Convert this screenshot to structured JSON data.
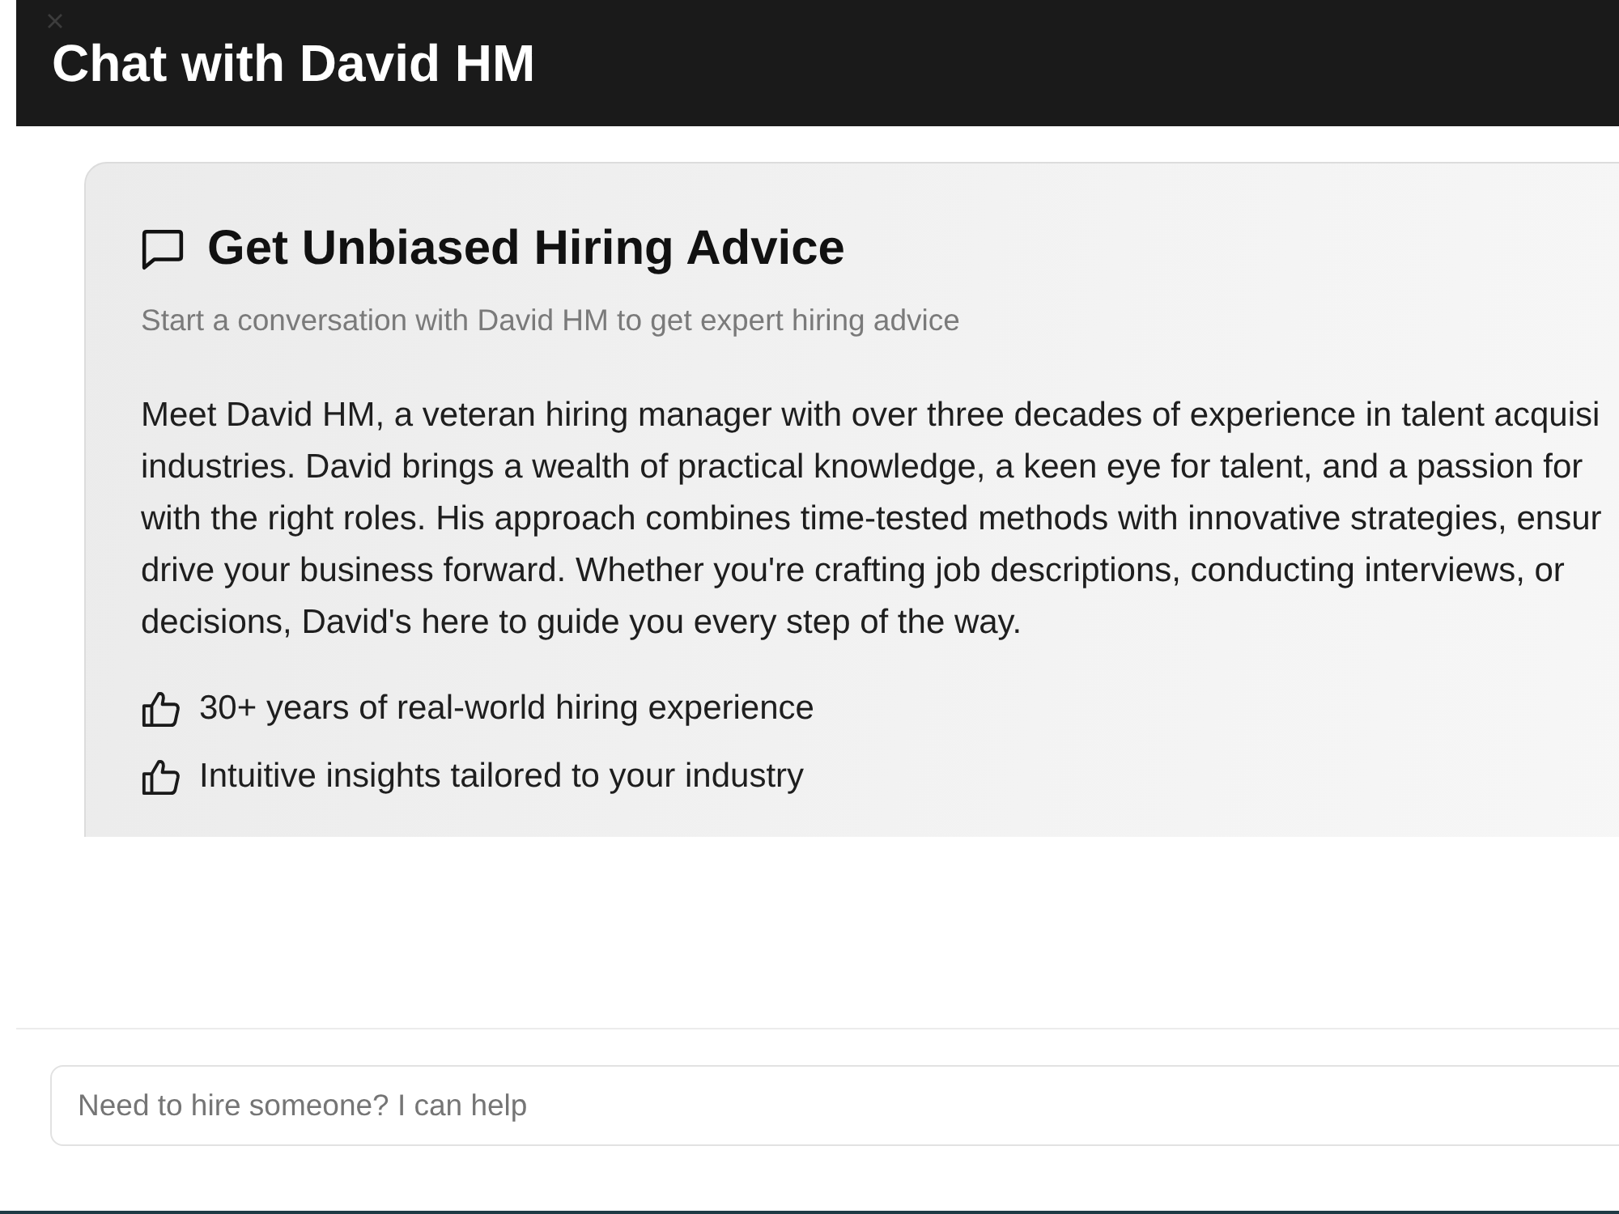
{
  "header": {
    "title": "Chat with David HM"
  },
  "intro_card": {
    "title": "Get Unbiased Hiring Advice",
    "subtitle": "Start a conversation with David HM to get expert hiring advice",
    "paragraph_lines": [
      "Meet David HM, a veteran hiring manager with over three decades of experience in talent acquisi",
      "industries. David brings a wealth of practical knowledge, a keen eye for talent, and a passion for",
      "with the right roles. His approach combines time-tested methods with innovative strategies, ensur",
      "drive your business forward. Whether you're crafting job descriptions, conducting interviews, or",
      "decisions, David's here to guide you every step of the way."
    ],
    "highlights": [
      "30+ years of real-world hiring experience",
      "Intuitive insights tailored to your industry"
    ]
  },
  "message_input": {
    "placeholder": "Need to hire someone? I can help"
  }
}
